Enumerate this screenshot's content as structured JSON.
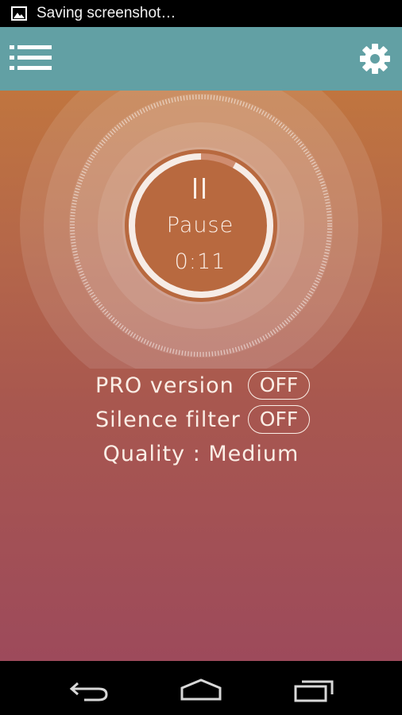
{
  "status_bar": {
    "notification_icon": "image-icon",
    "text": "Saving screenshot…"
  },
  "toolbar": {
    "menu_icon": "list-menu-icon",
    "settings_icon": "gear-icon",
    "color": "#62a0a4"
  },
  "recorder": {
    "state_icon": "pause-icon",
    "state_label": "Pause",
    "elapsed": "0:11",
    "progress_fraction": 0.92
  },
  "options": {
    "pro_version": {
      "label": "PRO version",
      "value": "OFF"
    },
    "silence_filter": {
      "label": "Silence filter",
      "value": "OFF"
    },
    "quality": "Quality : Medium"
  },
  "nav_bar": {
    "back_icon": "back-icon",
    "home_icon": "home-icon",
    "recents_icon": "recents-icon"
  },
  "colors": {
    "gradient_top": "#c0753f",
    "gradient_bottom": "#9d4a5b",
    "record_fill": "#b8693f",
    "text": "#fbeee6"
  }
}
